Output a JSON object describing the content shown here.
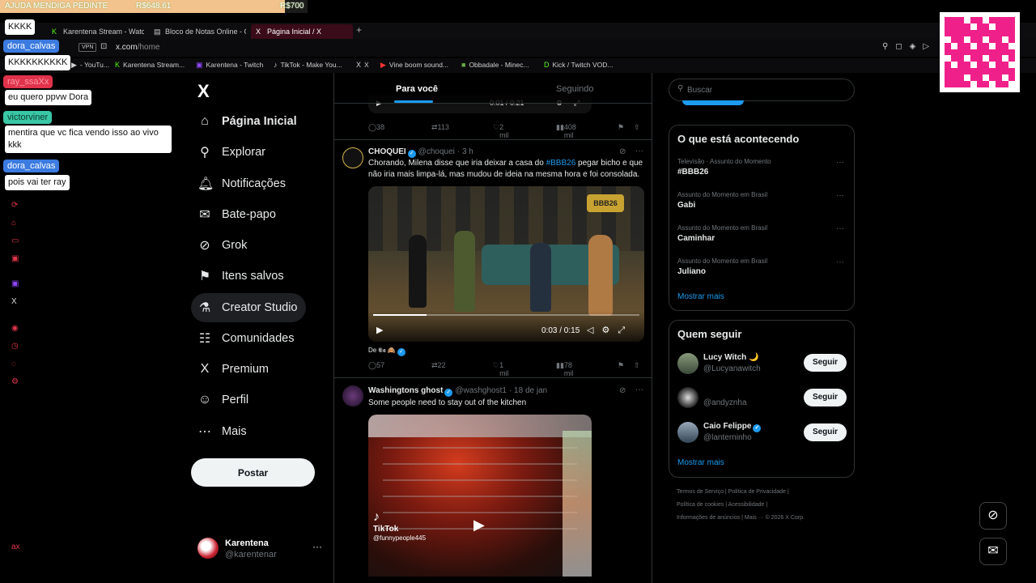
{
  "donation": {
    "title": "AJUDA MENDIGA PEDINTE",
    "current": "R$648.61",
    "goal": "R$700",
    "progress": 0.927
  },
  "browser": {
    "tabs": [
      {
        "label": "Karentena Stream - Watch",
        "icon": "K"
      },
      {
        "label": "Bloco de Notas Online - C",
        "icon": "▤"
      },
      {
        "label": "Página Inicial / X",
        "icon": "X"
      }
    ],
    "new_tab": "+",
    "vpn": "VPN",
    "url_domain": "x.com",
    "url_path": "/home",
    "bookmarks": [
      {
        "label": "- YouTu...",
        "icon": "▶"
      },
      {
        "label": "Karentena Stream...",
        "icon": "K"
      },
      {
        "label": "Karentena - Twitch",
        "icon": "▣"
      },
      {
        "label": "TikTok - Make You...",
        "icon": "♪"
      },
      {
        "label": "X",
        "icon": "X"
      },
      {
        "label": "Vine boom sound...",
        "icon": "▶"
      },
      {
        "label": "Obbadale - Minec...",
        "icon": "■"
      },
      {
        "label": "Kick / Twitch VOD...",
        "icon": "D"
      }
    ]
  },
  "chat": [
    {
      "user": "",
      "message": "KKKK",
      "user_color": "#3b7be0"
    },
    {
      "user": "dora_calvas",
      "message": "KKKKKKKKKK",
      "user_color": "#3b7be0"
    },
    {
      "user": "ray_ssaXx",
      "message": "eu quero ppvw Dora",
      "user_color": "#e0334b"
    },
    {
      "user": "victorviner",
      "message": "mentira que vc fica vendo isso ao vivo kkk",
      "user_color": "#39c7a6"
    },
    {
      "user": "dora_calvas",
      "message": "pois vai ter ray",
      "user_color": "#3b7be0"
    }
  ],
  "nav": {
    "logo": "X",
    "items": [
      {
        "label": "Página Inicial",
        "icon": "home"
      },
      {
        "label": "Explorar",
        "icon": "search"
      },
      {
        "label": "Notificações",
        "icon": "bell"
      },
      {
        "label": "Bate-papo",
        "icon": "mail"
      },
      {
        "label": "Grok",
        "icon": "grok"
      },
      {
        "label": "Itens salvos",
        "icon": "bookmark"
      },
      {
        "label": "Creator Studio",
        "icon": "flask"
      },
      {
        "label": "Comunidades",
        "icon": "people"
      },
      {
        "label": "Premium",
        "icon": "x"
      },
      {
        "label": "Perfil",
        "icon": "person"
      },
      {
        "label": "Mais",
        "icon": "more"
      }
    ],
    "post_button": "Postar",
    "account_name": "Karentena",
    "account_handle": "@karentenar",
    "account_more": "···"
  },
  "feed": {
    "tabs": {
      "for_you": "Para você",
      "following": "Seguindo"
    },
    "prev_tweet": {
      "video_time": "0:01 / 0:21",
      "replies": "38",
      "reposts": "113",
      "likes": "2 mil",
      "views": "408 mil"
    },
    "tweet1": {
      "author": "CHOQUEI",
      "handle": "@choquei",
      "time": "· 3 h",
      "text_before": "Chorando, Milena disse que iria deixar a casa do ",
      "hashtag": "#BBB26",
      "text_after": " pegar bicho e que não iria mais limpa-lá, mas mudou de ideia na mesma hora e foi consolada.",
      "video_logo": "BBB26",
      "video_time": "0:03 / 0:15",
      "video_progress": 0.2,
      "credit": "De 𝕰𝖆 🙈",
      "replies": "57",
      "reposts": "22",
      "likes": "1 mil",
      "views": "78 mil"
    },
    "tweet2": {
      "author": "Washingtons ghost",
      "handle": "@washghost1",
      "time": "· 18 de jan",
      "text": "Some people need to stay out of the kitchen",
      "tiktok": "TikTok",
      "tiktok_user": "@funnypeople445"
    }
  },
  "right": {
    "search_placeholder": "Buscar",
    "trends_title": "O que está acontecendo",
    "trends": [
      {
        "meta": "Televisão · Assunto do Momento",
        "name": "#BBB26"
      },
      {
        "meta": "Assunto do Momento em Brasil",
        "name": "Gabi"
      },
      {
        "meta": "Assunto do Momento em Brasil",
        "name": "Caminhar"
      },
      {
        "meta": "Assunto do Momento em Brasil",
        "name": "Juliano"
      }
    ],
    "trends_more": "Mostrar mais",
    "follow_title": "Quem seguir",
    "follow": [
      {
        "name": "Lucy Witch 🌙",
        "handle": "@Lucyanawitch",
        "button": "Seguir"
      },
      {
        "name": "",
        "handle": "@andyznha",
        "button": "Seguir"
      },
      {
        "name": "Caio Felippe",
        "handle": "@lanterninho",
        "button": "Seguir"
      }
    ],
    "follow_more": "Mostrar mais",
    "footer_line1": "Termos de Serviço  |  Política de Privacidade  |",
    "footer_line2": "Política de cookies  |  Acessibilidade  |",
    "footer_line3": "Informações de anúncios  |  Mais ···   © 2026 X Corp."
  }
}
